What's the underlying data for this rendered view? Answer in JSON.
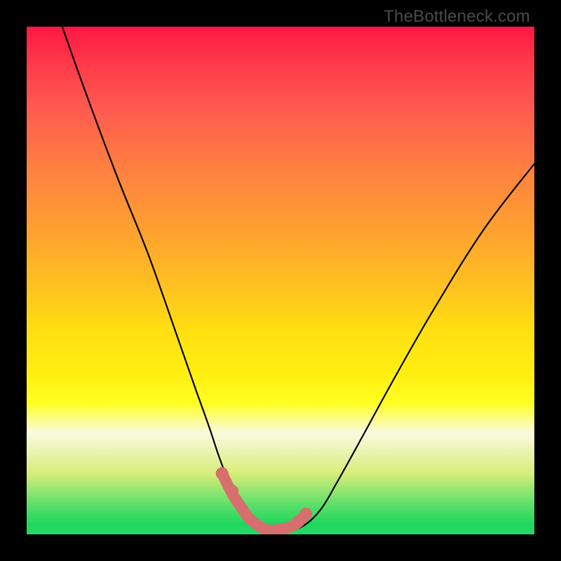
{
  "watermark": "TheBottleneck.com",
  "chart_data": {
    "type": "line",
    "title": "",
    "xlabel": "",
    "ylabel": "",
    "xlim": [
      0,
      100
    ],
    "ylim": [
      0,
      100
    ],
    "series": [
      {
        "name": "curve",
        "x": [
          7,
          12,
          18,
          24,
          30,
          33.5,
          36,
          38,
          40,
          42,
          43.5,
          45,
          48,
          52,
          55,
          58,
          61,
          66,
          72,
          80,
          90,
          100
        ],
        "y": [
          100,
          86,
          70,
          55,
          38,
          28,
          21,
          15,
          10,
          6,
          3.5,
          2,
          0.8,
          0.8,
          2,
          5,
          10,
          19,
          30,
          44,
          60,
          73
        ]
      }
    ],
    "highlight": {
      "name": "min-region",
      "x": [
        38.5,
        40.5,
        42.5,
        44,
        47,
        50,
        53,
        55
      ],
      "y": [
        12,
        8,
        5,
        3,
        1,
        1,
        2,
        4
      ],
      "dots_x": [
        38.5,
        40.5,
        53.5,
        55
      ],
      "dots_y": [
        12,
        8.5,
        2.5,
        4
      ]
    },
    "background_gradient": {
      "top": "#ff1744",
      "mid": "#ffee10",
      "bottom": "#25da66"
    }
  }
}
